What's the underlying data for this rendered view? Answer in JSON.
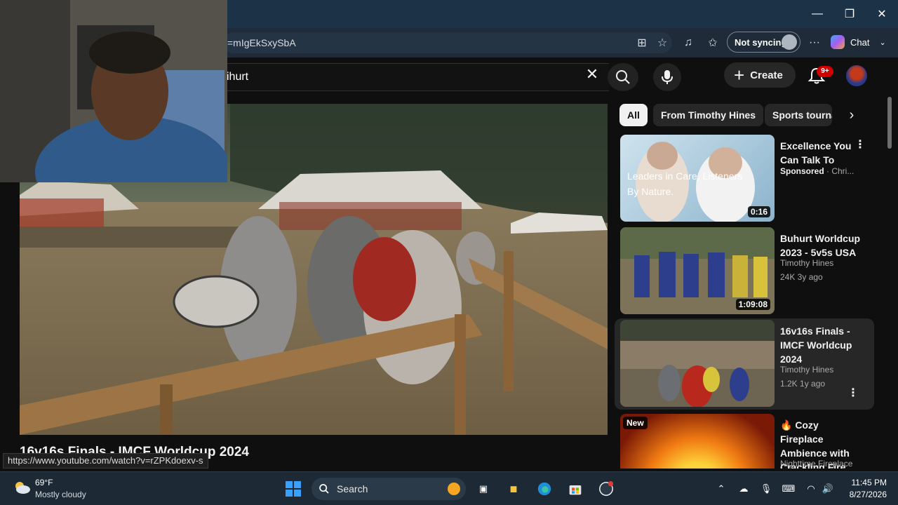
{
  "browser": {
    "url_fragment": "=mIgEkSxySbA",
    "sync_label": "Not syncing",
    "chat_label": "Chat"
  },
  "youtube": {
    "search_query": "ihurt",
    "create_label": "Create",
    "notification_badge": "9+",
    "video_title": "16v16s Finals - IMCF Worldcup 2024",
    "status_url": "https://www.youtube.com/watch?v=rZPKdoexv-s",
    "chips": [
      "All",
      "From Timothy Hines",
      "Sports tourna"
    ],
    "recommended": [
      {
        "title": "Excellence You Can Talk To",
        "channel": "Sponsored",
        "channel_suffix": "· Chri...",
        "meta": "",
        "duration": "0:16",
        "thumb_text": "Leaders in Care, Listeners By Nature.",
        "badge": ""
      },
      {
        "title": "Buhurt Worldcup 2023 - 5v5s USA",
        "channel": "Timothy Hines",
        "meta": "24K  3y ago",
        "duration": "1:09:08",
        "badge": ""
      },
      {
        "title": "16v16s Finals - IMCF Worldcup 2024",
        "channel": "Timothy Hines",
        "meta": "1.2K  1y ago",
        "duration": "",
        "badge": ""
      },
      {
        "title": "🔥 Cozy Fireplace Ambience with Crackling Fire ...",
        "channel": "Nighttime Fireplace",
        "meta": "",
        "duration": "",
        "badge": "New"
      }
    ]
  },
  "taskbar": {
    "weather_temp": "69°F",
    "weather_desc": "Mostly cloudy",
    "search_placeholder": "Search",
    "time": "11:45 PM",
    "date": "8/27/2026"
  },
  "colors": {
    "yt_bg": "#0f0f0f",
    "chip_bg": "#272727",
    "badge_red": "#cc0000",
    "titlebar": "#1b3247",
    "taskbar": "#1d2a36"
  }
}
